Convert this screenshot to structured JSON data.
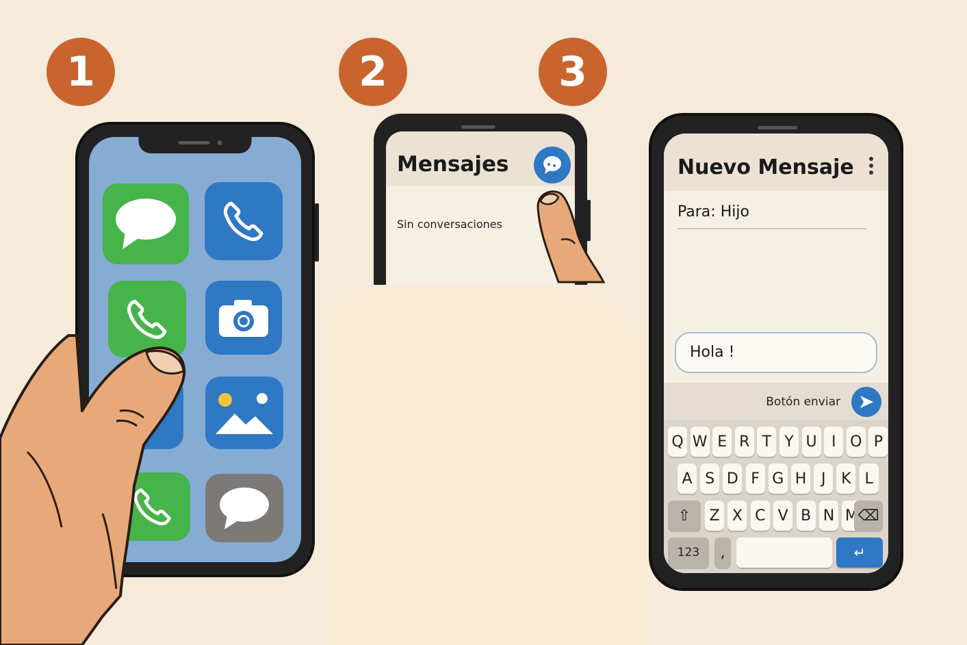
{
  "steps": {
    "one": "1",
    "two": "2",
    "three": "3"
  },
  "phone1": {
    "apps": [
      {
        "name": "messages-icon"
      },
      {
        "name": "phone-icon"
      },
      {
        "name": "phone-icon"
      },
      {
        "name": "camera-icon"
      },
      {
        "name": "photos-icon"
      },
      {
        "name": "phone-icon"
      },
      {
        "name": "chat-icon"
      }
    ]
  },
  "phone2": {
    "title": "Mensajes",
    "empty_text": "Sin conversaciones",
    "new_message_icon": "new-chat-icon"
  },
  "phone3": {
    "title": "Nuevo Mensaje",
    "to_label": "Para:",
    "to_value": "Hijo",
    "message_value": "Hola !",
    "send_label": "Botón enviar",
    "keyboard": {
      "row1": [
        "Q",
        "W",
        "E",
        "R",
        "T",
        "Y",
        "U",
        "I",
        "O",
        "P"
      ],
      "row2": [
        "A",
        "S",
        "D",
        "F",
        "G",
        "H",
        "J",
        "K",
        "L"
      ],
      "row3": [
        "Z",
        "X",
        "C",
        "V",
        "B",
        "N",
        "M"
      ],
      "numbers_key": "123",
      "comma_key": ","
    }
  },
  "colors": {
    "background": "#f6eadb",
    "step_badge": "#c9642e",
    "accent_blue": "#2f78c3",
    "app_green": "#46b34b"
  }
}
